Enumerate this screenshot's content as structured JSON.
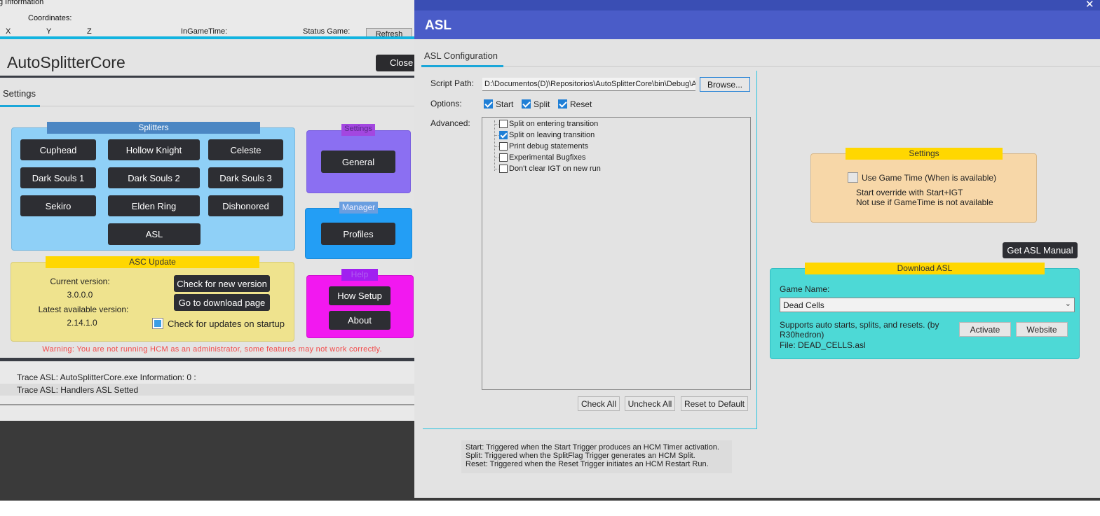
{
  "debug": {
    "section_label": "g Information",
    "coordinates_label": "Coordinates:",
    "x_label": "X",
    "y_label": "Y",
    "z_label": "Z",
    "igt_label": "InGameTime:",
    "status_label": "Status Game:",
    "refresh_label": "Refresh"
  },
  "core": {
    "title": "AutoSplitterCore",
    "close_label": "Close",
    "tab_label": "Settings",
    "splitters_header": "Splitters",
    "splitters": [
      "Cuphead",
      "Hollow Knight",
      "Celeste",
      "Dark Souls 1",
      "Dark Souls 2",
      "Dark Souls 3",
      "Sekiro",
      "Elden Ring",
      "Dishonored",
      "ASL"
    ],
    "settings_header": "Settings",
    "general_label": "General",
    "manager_header": "Manager",
    "profiles_label": "Profiles",
    "help_header": "Help",
    "how_setup_label": "How Setup",
    "about_label": "About",
    "update_header": "ASC Update",
    "current_version_label": "Current version:",
    "current_version": "3.0.0.0",
    "latest_version_label": "Latest available version:",
    "latest_version": "2.14.1.0",
    "check_new_label": "Check for new version",
    "download_page_label": "Go to download page",
    "check_startup_label": "Check for updates on startup",
    "warning": "Warning: You are not running HCM as an administrator, some features may not work correctly."
  },
  "log": {
    "lines": [
      "Trace ASL: AutoSplitterCore.exe Information: 0 :",
      "Trace ASL: Handlers ASL Setted"
    ]
  },
  "asl": {
    "title": "ASL",
    "close_glyph": "✕",
    "tab_label": "ASL Configuration",
    "script_path_label": "Script Path:",
    "script_path": "D:\\Documentos(D)\\Repositorios\\AutoSplitterCore\\bin\\Debug\\A",
    "browse_label": "Browse...",
    "options_label": "Options:",
    "options": [
      {
        "label": "Start",
        "checked": true
      },
      {
        "label": "Split",
        "checked": true
      },
      {
        "label": "Reset",
        "checked": true
      }
    ],
    "advanced_label": "Advanced:",
    "advanced_items": [
      {
        "label": "Split on entering transition",
        "checked": false
      },
      {
        "label": "Split on leaving transition",
        "checked": true
      },
      {
        "label": "Print debug statements",
        "checked": false
      },
      {
        "label": "Experimental Bugfixes",
        "checked": false
      },
      {
        "label": "Don't clear IGT on new run",
        "checked": false
      }
    ],
    "check_all_label": "Check All",
    "uncheck_all_label": "Uncheck All",
    "reset_default_label": "Reset to Default",
    "legend_lines": [
      "Start: Triggered when the Start Trigger produces an HCM Timer activation.",
      "Split: Triggered when the SplitFlag Trigger generates an HCM Split.",
      "Reset: Triggered when the Reset Trigger initiates an HCM Restart Run."
    ],
    "settings_header": "Settings",
    "use_game_time_label": "Use Game Time (When is available)",
    "use_game_time_checked": false,
    "start_override_note": "Start override with Start+IGT",
    "not_use_note": "Not use if GameTime is not available",
    "manual_label": "Get ASL Manual",
    "download_header": "Download ASL",
    "game_name_label": "Game Name:",
    "game_name_value": "Dead Cells",
    "description": "Supports auto starts, splits, and resets. (by R30hedron)",
    "file": "File: DEAD_CELLS.asl",
    "activate_label": "Activate",
    "website_label": "Website"
  },
  "colors": {
    "asl_header": "#4a5cc8",
    "accent_cyan": "#12b4e0",
    "splitters_bg": "#8fd0f7",
    "update_bg": "#efe38e",
    "warning": "#f24a4a",
    "download_bg": "#4dd9d6",
    "asl_settings_bg": "#f7d7a8"
  }
}
